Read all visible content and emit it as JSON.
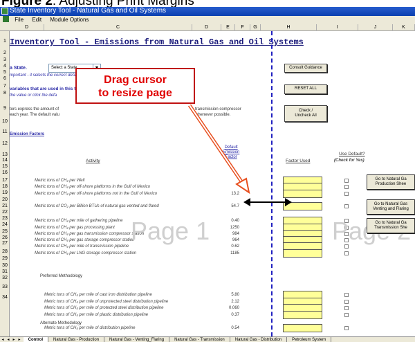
{
  "figure_caption": {
    "label": "Figure 2",
    "rest": ":  Adjusting Print Margins"
  },
  "window": {
    "title": "State Inventory Tool - Natural Gas and Oil Systems"
  },
  "menu": {
    "items": [
      "File",
      "Edit",
      "Module Options"
    ]
  },
  "columns": [
    "D",
    "C",
    "D",
    "E",
    "F",
    "G",
    "H",
    "I",
    "J",
    "K"
  ],
  "rows": [
    "1",
    "2",
    "3",
    "4",
    "5",
    "6",
    "7",
    "8",
    "9",
    "10",
    "11",
    "12",
    "13",
    "14",
    "15",
    "16",
    "17",
    "18",
    "19",
    "20",
    "21",
    "22",
    "23",
    "24",
    "25",
    "26",
    "27",
    "28",
    "29",
    "30",
    "31",
    "32",
    "33",
    "34"
  ],
  "sheet": {
    "title": "Inventory Tool - Emissions from Natural Gas and Oil Systems",
    "select_state_label": "a State.",
    "select_state_value": "Select a State . . .",
    "important_note": "mportant - it selects the correct default variables for your state.",
    "variables_text": "variables that are used in this tool and click to proceed to the respective worksheets.",
    "click_text": "the value or click the defa",
    "express_text_1": "tors express the amount of",
    "express_text_2": "each year. The default valu",
    "express_text_3": "transmission compressor",
    "express_text_4": "whenever possible.",
    "emission_factors": "Emission Factors",
    "activity_header": "Activity",
    "default_factor_header": "Default\nEmission\nFactor",
    "factor_used_header": "Factor Used",
    "use_default_header": "Use Default?",
    "check_yes_header": "(Check for Yes)",
    "preferred": "Preferred Methodology",
    "alternate": "Alternate Methodology",
    "activities": [
      {
        "text": "Metric tons of CH₄ per Well",
        "value": ""
      },
      {
        "text": "Metric tons of CH₄ per off-shore platforms in the Gulf of Mexico",
        "value": ""
      },
      {
        "text": "Metric tons of CH₄ per off-shore platforms not in the Gulf of Mexico",
        "value": "13.2"
      },
      {
        "text": "Metric tons of CO₂ per Billion BTUs of natural gas vented and flared",
        "value": "54.7"
      },
      {
        "text": "Metric tons of CH₄ per mile of gathering pipeline",
        "value": "0.40"
      },
      {
        "text": "Metric tons of CH₄ per gas processing plant",
        "value": "1250"
      },
      {
        "text": "Metric tons of CH₄ per gas transmission compressor station",
        "value": "984"
      },
      {
        "text": "Metric tons of CH₄ per gas storage compressor station",
        "value": "964"
      },
      {
        "text": "Metric tons of CH₄ per mile of transmission pipeline",
        "value": "0.62"
      },
      {
        "text": "Metric tons of CH₄ per LNG storage compressor station",
        "value": "1185"
      },
      {
        "text": "Metric tons of CH₄ per mile of cast iron distribution pipeline",
        "value": "5.80"
      },
      {
        "text": "Metric tons of CH₄ per mile of unprotected steel distribution pipeline",
        "value": "2.12"
      },
      {
        "text": "Metric tons of CH₄ per mile of protected steel distribution pipeline",
        "value": "0.060"
      },
      {
        "text": "Metric tons of CH₄ per mile of plastic distribution pipeline",
        "value": "0.37"
      },
      {
        "text": "Metric tons of CH₄ per mile of distribution pipeline",
        "value": "0.54"
      }
    ],
    "buttons": {
      "consult": "Consult Guidance",
      "reset": "RESET ALL",
      "check": "Check /\nUncheck All",
      "goto_production": "Go to Natural Ga\nProduction Shee",
      "goto_venting": "Go to Natural Gas\nVenting and Flaring",
      "goto_transmission": "Go to Natural Ga\nTransmission She"
    },
    "page1_watermark": "Page 1",
    "page2_watermark": "Page 2"
  },
  "callout": {
    "text": "Drag cursor\nto resize page"
  },
  "tabs": [
    "Control",
    "Natural Gas - Production",
    "Natural Gas - Venting_Flaring",
    "Natural Gas - Transmission",
    "Natural Gas - Distribution",
    "Petroleum System"
  ],
  "colors": {
    "accent": "#c01010",
    "input_fill": "#ffff99",
    "page_break": "#2020c0",
    "title": "#1a1a7a"
  }
}
